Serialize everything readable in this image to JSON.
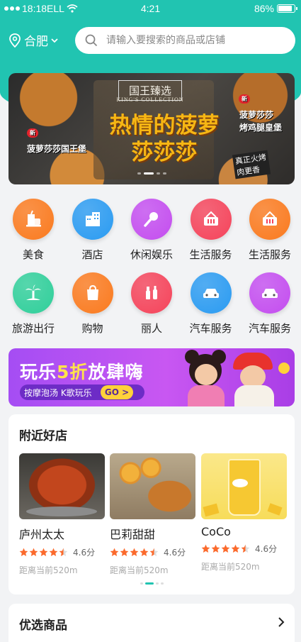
{
  "status_bar": {
    "carrier": "18:18ELL",
    "time": "4:21",
    "battery": "86%",
    "battery_level": 0.86
  },
  "header": {
    "city": "合肥",
    "search_placeholder": "请输入要搜索的商品或店铺"
  },
  "banner": {
    "tag": "国王臻选",
    "tag_en": "KING'S COLLECTION",
    "headline_line1": "热情的菠萝",
    "headline_line2": "莎莎莎",
    "new_badge": "新",
    "label_left": "菠萝莎莎国王堡",
    "label_right_line1": "菠萝莎莎",
    "label_right_line2": "烤鸡腿皇堡",
    "stamp_line1": "真正火烤",
    "stamp_line2": "肉更香",
    "active_slide": 2,
    "slide_count": 4
  },
  "categories": [
    {
      "label": "美食",
      "icon": "food-icon",
      "color": "#fb7a1e"
    },
    {
      "label": "酒店",
      "icon": "hotel-icon",
      "color": "#2a9bf2"
    },
    {
      "label": "休闲娱乐",
      "icon": "microphone-icon",
      "color": "#c44df0"
    },
    {
      "label": "生活服务",
      "icon": "basket-icon",
      "color": "#f5435a"
    },
    {
      "label": "生活服务",
      "icon": "basket-icon",
      "color": "#fb7a1e"
    },
    {
      "label": "旅游出行",
      "icon": "palm-tree-icon",
      "color": "#2fcf9a"
    },
    {
      "label": "购物",
      "icon": "shopping-bag-icon",
      "color": "#fb7a1e"
    },
    {
      "label": "丽人",
      "icon": "beauty-icon",
      "color": "#f5435a"
    },
    {
      "label": "汽车服务",
      "icon": "car-icon",
      "color": "#2a9bf2"
    },
    {
      "label": "汽车服务",
      "icon": "car-icon",
      "color": "#c44df0"
    }
  ],
  "promo": {
    "title_a": "玩乐",
    "title_hl": "5折",
    "title_b": "放肆嗨",
    "subtitle": "按摩泡汤  K歌玩乐",
    "go": "GO >"
  },
  "nearby": {
    "title": "附近好店",
    "shops": [
      {
        "name": "庐州太太",
        "rating": "4.6分",
        "stars": 4.5,
        "distance": "距离当前520m"
      },
      {
        "name": "巴莉甜甜",
        "rating": "4.6分",
        "stars": 4.5,
        "distance": "距离当前520m"
      },
      {
        "name": "CoCo",
        "rating": "4.6分",
        "stars": 4.5,
        "distance": "距离当前520m"
      }
    ],
    "active_page": 1,
    "page_count": 4
  },
  "featured": {
    "title": "优选商品"
  },
  "colors": {
    "brand": "#21c4b1",
    "star": "#fb6a2c",
    "promo_highlight": "#ffe34a"
  }
}
